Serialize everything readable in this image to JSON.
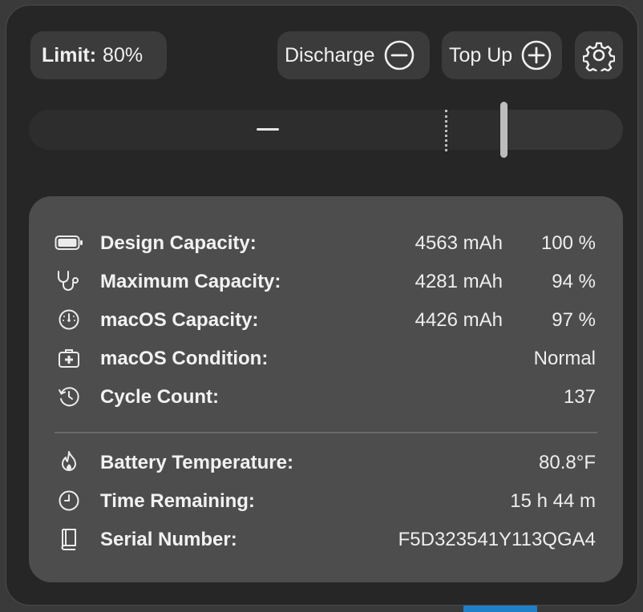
{
  "header": {
    "limit_label": "Limit:",
    "limit_value": "80%",
    "discharge_label": "Discharge",
    "topup_label": "Top Up",
    "settings_icon": "gear-icon"
  },
  "slider": {
    "limit_percent": 80,
    "charge_marker_percent": 70,
    "state_symbol": "minus"
  },
  "battery_info": [
    {
      "icon": "battery-icon",
      "label": "Design Capacity:",
      "mah": "4563 mAh",
      "value": "100 %"
    },
    {
      "icon": "stethoscope-icon",
      "label": "Maximum Capacity:",
      "mah": "4281 mAh",
      "value": "94 %"
    },
    {
      "icon": "gauge-icon",
      "label": "macOS Capacity:",
      "mah": "4426 mAh",
      "value": "97 %"
    },
    {
      "icon": "medical-bag-icon",
      "label": "macOS Condition:",
      "mah": "",
      "value": "Normal"
    },
    {
      "icon": "history-icon",
      "label": "Cycle Count:",
      "mah": "",
      "value": "137"
    }
  ],
  "extra_info": [
    {
      "icon": "flame-icon",
      "label": "Battery Temperature:",
      "value": "80.8°F"
    },
    {
      "icon": "clock-icon",
      "label": "Time Remaining:",
      "value": "15 h 44 m"
    },
    {
      "icon": "book-icon",
      "label": "Serial Number:",
      "value": "F5D323541Y113QGA4"
    }
  ]
}
